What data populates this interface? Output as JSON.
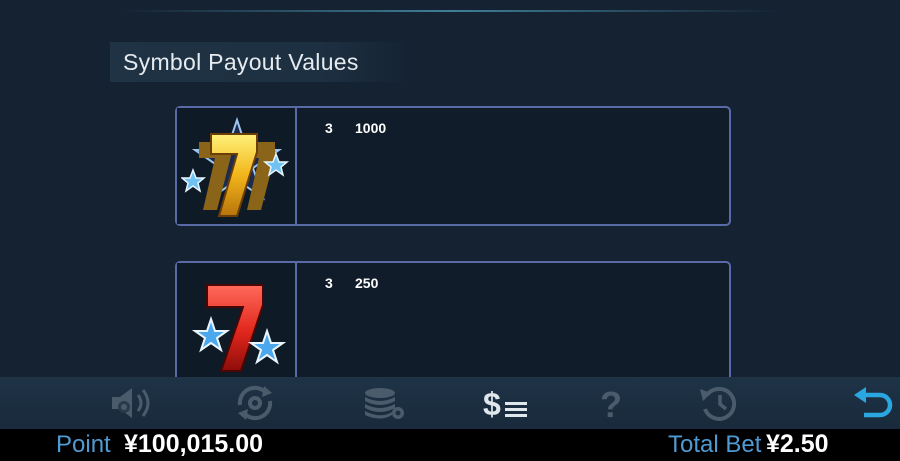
{
  "section": {
    "title": "Symbol Payout Values"
  },
  "payouts": [
    {
      "symbol": "gold-seven-stars-icon",
      "count": "3",
      "value": "1000"
    },
    {
      "symbol": "red-seven-stars-icon",
      "count": "3",
      "value": "250"
    }
  ],
  "toolbar": {
    "items": [
      {
        "icon": "sound-settings-icon",
        "active": false
      },
      {
        "icon": "autoplay-settings-icon",
        "active": false
      },
      {
        "icon": "bet-settings-icon",
        "active": false
      },
      {
        "icon": "paytable-icon",
        "active": true
      },
      {
        "icon": "help-icon",
        "active": false
      },
      {
        "icon": "history-icon",
        "active": false
      },
      {
        "icon": "back-arrow-icon",
        "active": true
      }
    ]
  },
  "status": {
    "point_label": "Point",
    "point_value": "¥100,015.00",
    "bet_label": "Total Bet",
    "bet_value": "¥2.50"
  },
  "colors": {
    "background": "#152232",
    "card_border": "#5a6aa6",
    "label_blue": "#4f9ad2",
    "icon_inactive": "#4a5c6c",
    "back_icon": "#2aa6e0"
  }
}
